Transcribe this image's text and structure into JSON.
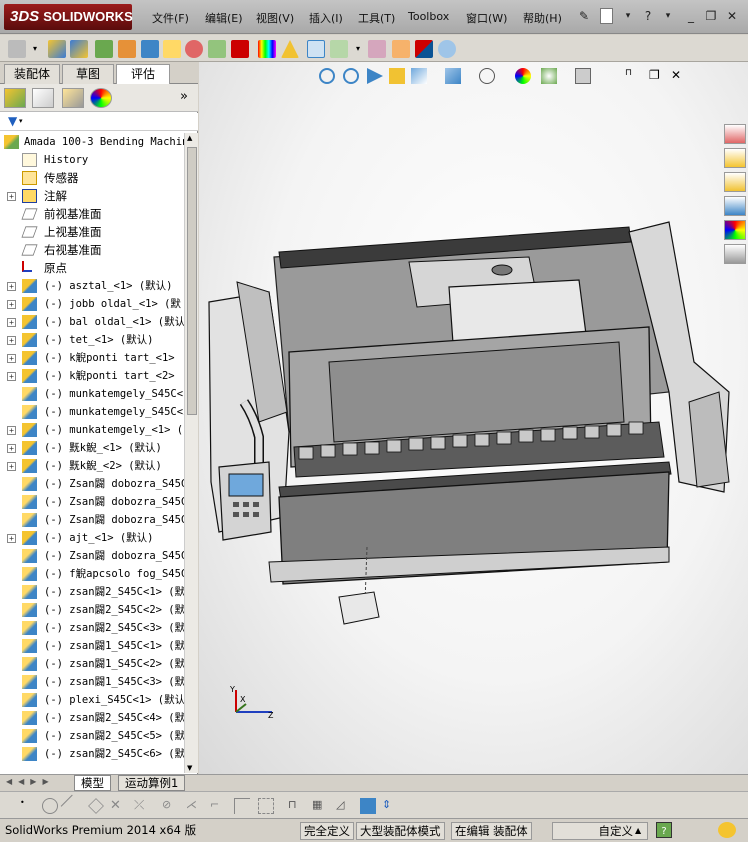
{
  "app": {
    "logo_text": "SOLIDWORKS",
    "logo_prefix": "3DS"
  },
  "menu": [
    "文件(F)",
    "编辑(E)",
    "视图(V)",
    "插入(I)",
    "工具(T)",
    "Toolbox",
    "窗口(W)",
    "帮助(H)"
  ],
  "left_tabs": [
    "装配体",
    "草图",
    "评估"
  ],
  "active_tab_index": 2,
  "tree": [
    {
      "label": "Amada 100-3 Bending Machin",
      "expander": "",
      "icon": "assembly-icon",
      "root": true
    },
    {
      "label": "History",
      "expander": "",
      "icon": "history-icon"
    },
    {
      "label": "传感器",
      "expander": "",
      "icon": "sensor-icon",
      "cjk": true
    },
    {
      "label": "注解",
      "expander": "+",
      "icon": "annotation-icon",
      "cjk": true
    },
    {
      "label": "前视基准面",
      "expander": "",
      "icon": "plane-icon",
      "cjk": true
    },
    {
      "label": "上视基准面",
      "expander": "",
      "icon": "plane-icon",
      "cjk": true
    },
    {
      "label": "右视基准面",
      "expander": "",
      "icon": "plane-icon",
      "cjk": true
    },
    {
      "label": "原点",
      "expander": "",
      "icon": "origin-icon",
      "cjk": true
    },
    {
      "label": "(-) asztal_<1> (默认)",
      "expander": "+",
      "icon": "subassembly-icon"
    },
    {
      "label": "(-) jobb oldal_<1> (默",
      "expander": "+",
      "icon": "subassembly-icon"
    },
    {
      "label": "(-) bal oldal_<1> (默认",
      "expander": "+",
      "icon": "subassembly-icon"
    },
    {
      "label": "(-) tet_<1> (默认)",
      "expander": "+",
      "icon": "subassembly-icon"
    },
    {
      "label": "(-) k觬ponti tart_<1>",
      "expander": "+",
      "icon": "subassembly-icon"
    },
    {
      "label": "(-) k觬ponti tart_<2>",
      "expander": "+",
      "icon": "subassembly-icon"
    },
    {
      "label": "(-) munkatemgely_S45C<1",
      "expander": "",
      "icon": "part-icon"
    },
    {
      "label": "(-) munkatemgely_S45C<2",
      "expander": "",
      "icon": "part-icon"
    },
    {
      "label": "(-) munkatemgely_<1> (",
      "expander": "+",
      "icon": "subassembly-icon"
    },
    {
      "label": "(-) 黖k觬_<1> (默认)",
      "expander": "+",
      "icon": "subassembly-icon"
    },
    {
      "label": "(-) 黖k觬_<2> (默认)",
      "expander": "+",
      "icon": "subassembly-icon"
    },
    {
      "label": "(-) Zsan闢 dobozra_S45C",
      "expander": "",
      "icon": "part-icon"
    },
    {
      "label": "(-) Zsan闢 dobozra_S45C",
      "expander": "",
      "icon": "part-icon"
    },
    {
      "label": "(-) Zsan闢 dobozra_S45C",
      "expander": "",
      "icon": "part-icon"
    },
    {
      "label": "(-) ajt_<1> (默认)",
      "expander": "+",
      "icon": "subassembly-icon"
    },
    {
      "label": "(-) Zsan闢 dobozra_S45C",
      "expander": "",
      "icon": "part-icon"
    },
    {
      "label": "(-) f觬apcsolo fog_S45C",
      "expander": "",
      "icon": "part-icon"
    },
    {
      "label": "(-) zsan闢2_S45C<1> (默",
      "expander": "",
      "icon": "part-icon"
    },
    {
      "label": "(-) zsan闢2_S45C<2> (默",
      "expander": "",
      "icon": "part-icon"
    },
    {
      "label": "(-) zsan闢2_S45C<3> (默",
      "expander": "",
      "icon": "part-icon"
    },
    {
      "label": "(-) zsan闢1_S45C<1> (默",
      "expander": "",
      "icon": "part-icon"
    },
    {
      "label": "(-) zsan闢1_S45C<2> (默",
      "expander": "",
      "icon": "part-icon"
    },
    {
      "label": "(-) zsan闢1_S45C<3> (默",
      "expander": "",
      "icon": "part-icon"
    },
    {
      "label": "(-) plexi_S45C<1> (默认",
      "expander": "",
      "icon": "part-icon"
    },
    {
      "label": "(-) zsan闢2_S45C<4> (默",
      "expander": "",
      "icon": "part-icon"
    },
    {
      "label": "(-) zsan闢2_S45C<5> (默",
      "expander": "",
      "icon": "part-icon"
    },
    {
      "label": "(-) zsan闢2_S45C<6> (默",
      "expander": "",
      "icon": "part-icon"
    }
  ],
  "bottom_tabs": [
    "模型",
    "运动算例1"
  ],
  "status": {
    "product": "SolidWorks Premium 2014 x64 版",
    "definition": "完全定义",
    "mode": "大型装配体模式",
    "editing": "在编辑 装配体",
    "units": "自定义"
  },
  "triad": {
    "y": "Y",
    "x": "X",
    "z": "Z"
  },
  "colors": {
    "brand": "#8b1a1a",
    "selection": "#316ac5"
  }
}
